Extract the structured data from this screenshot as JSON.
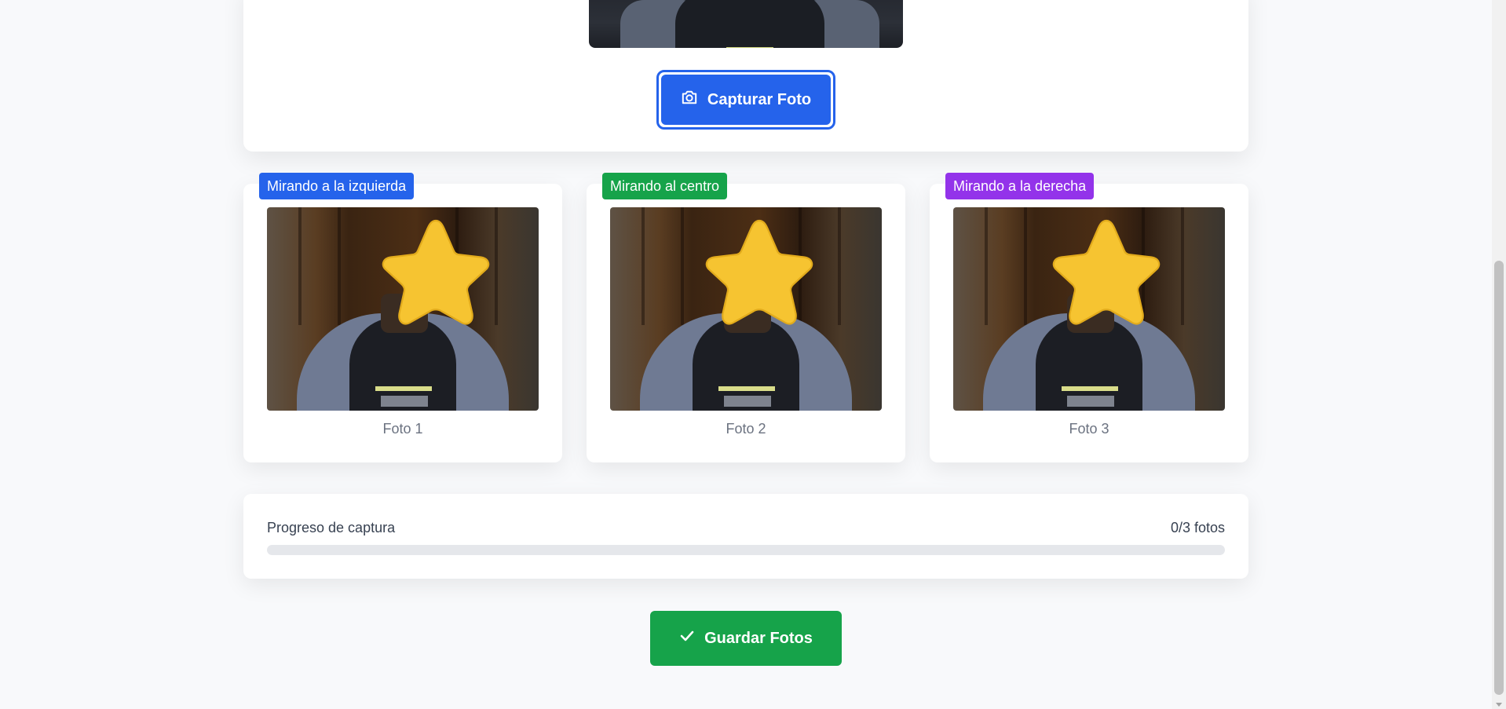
{
  "capture": {
    "button_label": "Capturar Foto",
    "icon": "camera-icon"
  },
  "photos": [
    {
      "badge": "Mirando a la izquierda",
      "badge_color": "#2563eb",
      "caption": "Foto 1"
    },
    {
      "badge": "Mirando al centro",
      "badge_color": "#16a34a",
      "caption": "Foto 2"
    },
    {
      "badge": "Mirando a la derecha",
      "badge_color": "#9333ea",
      "caption": "Foto 3"
    }
  ],
  "progress": {
    "label": "Progreso de captura",
    "count": "0/3 fotos",
    "fraction": 0
  },
  "save": {
    "button_label": "Guardar Fotos",
    "icon": "check-icon"
  },
  "colors": {
    "primary": "#2563eb",
    "success": "#16a34a",
    "purple": "#9333ea",
    "star": "#f6c431"
  }
}
